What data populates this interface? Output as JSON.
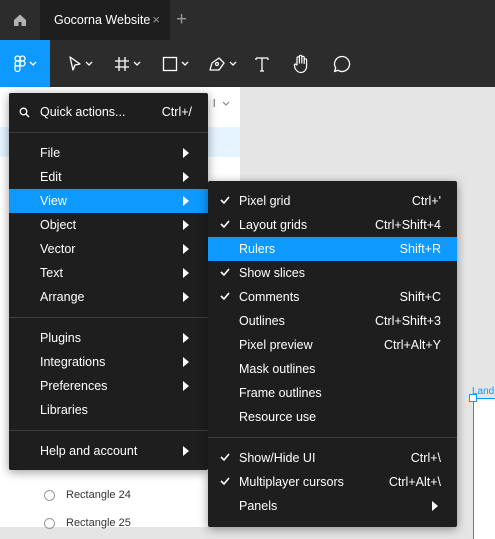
{
  "tabbar": {
    "home_icon": "home-icon",
    "tab_title": "Gocorna Website",
    "close_glyph": "×",
    "add_glyph": "+"
  },
  "toolbar": {
    "icons": [
      "figma-menu-icon",
      "move-tool-icon",
      "frame-tool-icon",
      "shape-tool-icon",
      "pen-tool-icon",
      "text-tool-icon",
      "hand-tool-icon",
      "comment-tool-icon"
    ]
  },
  "background": {
    "partial_dim_label": "l",
    "layers": [
      "Rectangle 24",
      "Rectangle 25"
    ],
    "frame_label": "Land"
  },
  "main_menu": {
    "quick_actions": {
      "label": "Quick actions...",
      "shortcut": "Ctrl+/"
    },
    "items": [
      {
        "label": "File"
      },
      {
        "label": "Edit"
      },
      {
        "label": "View"
      },
      {
        "label": "Object"
      },
      {
        "label": "Vector"
      },
      {
        "label": "Text"
      },
      {
        "label": "Arrange"
      },
      {
        "label": "Plugins"
      },
      {
        "label": "Integrations"
      },
      {
        "label": "Preferences"
      },
      {
        "label": "Libraries"
      },
      {
        "label": "Help and account"
      }
    ],
    "highlighted": "View"
  },
  "view_submenu": {
    "items": [
      {
        "label": "Pixel grid",
        "shortcut": "Ctrl+'",
        "checked": true
      },
      {
        "label": "Layout grids",
        "shortcut": "Ctrl+Shift+4",
        "checked": true
      },
      {
        "label": "Rulers",
        "shortcut": "Shift+R",
        "checked": false
      },
      {
        "label": "Show slices",
        "shortcut": "",
        "checked": true
      },
      {
        "label": "Comments",
        "shortcut": "Shift+C",
        "checked": true
      },
      {
        "label": "Outlines",
        "shortcut": "Ctrl+Shift+3",
        "checked": false
      },
      {
        "label": "Pixel preview",
        "shortcut": "Ctrl+Alt+Y",
        "checked": false
      },
      {
        "label": "Mask outlines",
        "shortcut": "",
        "checked": false
      },
      {
        "label": "Frame outlines",
        "shortcut": "",
        "checked": false
      },
      {
        "label": "Resource use",
        "shortcut": "",
        "checked": false
      },
      {
        "label": "Show/Hide UI",
        "shortcut": "Ctrl+\\",
        "checked": true
      },
      {
        "label": "Multiplayer cursors",
        "shortcut": "Ctrl+Alt+\\",
        "checked": true
      },
      {
        "label": "Panels",
        "shortcut": "",
        "checked": false
      }
    ],
    "highlighted": "Rulers"
  },
  "colors": {
    "accent": "#0d99ff",
    "menu_bg": "#1e1e1e",
    "bar_bg": "#2c2c2c"
  }
}
